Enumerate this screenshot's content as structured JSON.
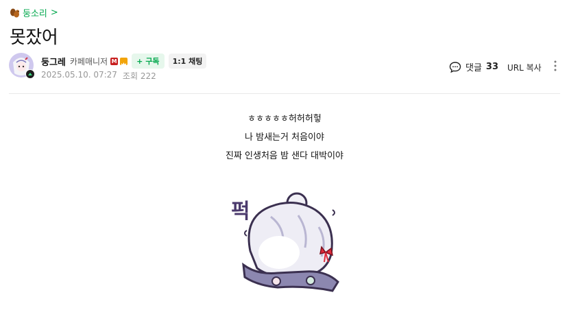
{
  "breadcrumb": {
    "board": "둥소리",
    "arrow": ">",
    "icon": "squirrel-icon"
  },
  "post": {
    "title": "못잤어",
    "author": {
      "nickname": "둥그레",
      "role": "카페매니저",
      "manager_badge": "M",
      "subscribe_label": "구독",
      "subscribe_plus": "+",
      "chat_label": "1:1 채팅"
    },
    "date": "2025.05.10. 07:27",
    "views_label": "조회 222",
    "comments_label": "댓글",
    "comments_count": "33",
    "url_copy_label": "URL 복사",
    "content_lines": [
      "ㅎㅎㅎㅎㅎ허허허헣",
      "나 밤새는거 처음이야",
      "진짜 인생처음 밤 샌다 대박이야"
    ],
    "sticker_text": "퍽"
  },
  "colors": {
    "accent": "#03a84e",
    "manager_badge": "#c81f1f"
  }
}
